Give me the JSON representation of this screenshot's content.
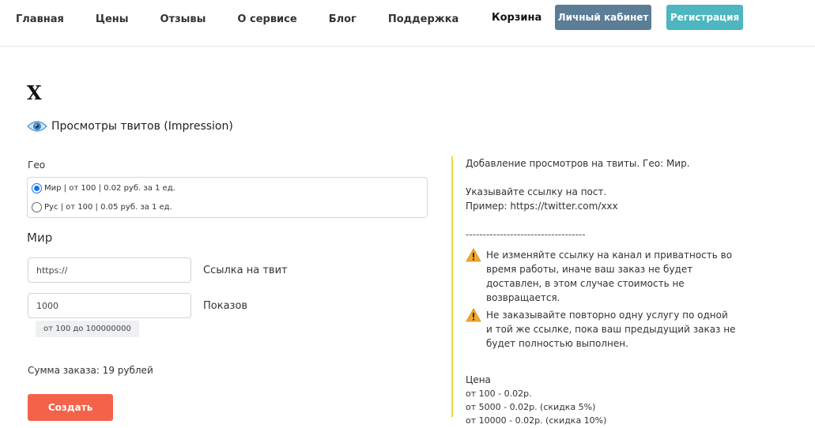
{
  "nav": {
    "items": [
      "Главная",
      "Цены",
      "Отзывы",
      "О сервисе",
      "Блог",
      "Поддержка"
    ],
    "cart": "Корзина",
    "cabinet": "Личный кабинет",
    "register": "Регистрация"
  },
  "service": {
    "title": "X",
    "subtitle": "Просмотры твитов (Impression)",
    "icon": "eye-icon"
  },
  "form": {
    "geo_label": "Гео",
    "geo_options": [
      {
        "label": "Мир | от 100 | 0.02 руб. за 1 ед.",
        "checked": true
      },
      {
        "label": "Рус | от 100 | 0.05 руб. за 1 ед.",
        "checked": false
      }
    ],
    "selected_heading": "Мир",
    "link_value": "https://",
    "link_label": "Ссылка на твит",
    "qty_value": "1000",
    "qty_label": "Показов",
    "qty_hint": "от 100 до 100000000",
    "sum": "Сумма заказа: 19 рублей",
    "create": "Создать"
  },
  "info": {
    "intro": "Добавление просмотров на твиты. Гео: Мир.",
    "instruction": "Указывайте ссылку на пост.",
    "example": "Пример: https://twitter.com/xxx",
    "divider": "-----------------------------------",
    "warning1": "Не изменяйте ссылку на канал и приватность во время работы, иначе ваш заказ не будет доставлен, в этом случае стоимость не возвращается.",
    "warning2": "Не заказывайте повторно одну услугу по одной и той же ссылке, пока ваш предыдущий заказ не будет полностью выполнен.",
    "price_title": "Цена",
    "price_lines": [
      "от 100 - 0.02р.",
      "от 5000 - 0.02р. (скидка 5%)",
      "от 10000 - 0.02р. (скидка 10%)"
    ]
  },
  "colors": {
    "cabinet": "#5b7d96",
    "register": "#4db6c0",
    "create": "#f5624a",
    "info_border": "#f2d53c",
    "warning": "#f0a92c"
  }
}
